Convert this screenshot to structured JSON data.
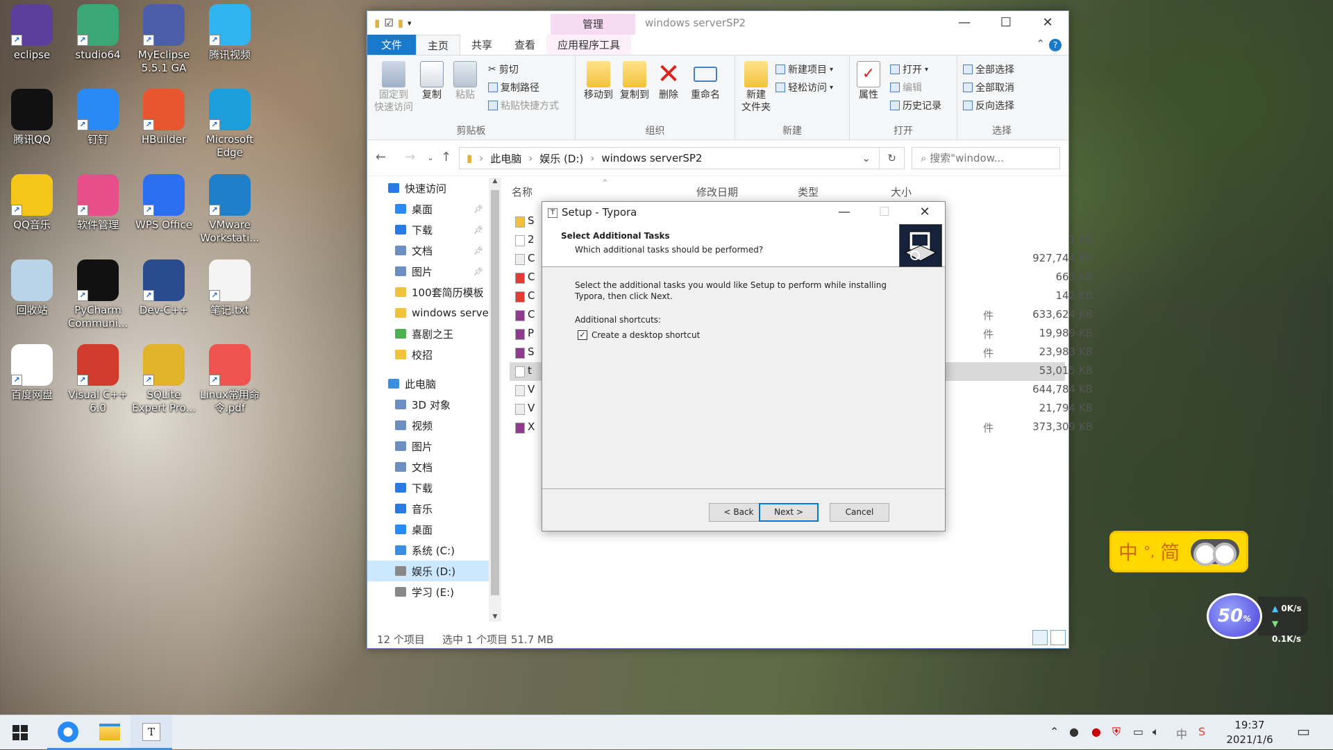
{
  "desktop": [
    {
      "label": "eclipse",
      "icon": "eclipse-icon",
      "color": "#5a3f9c"
    },
    {
      "label": "studio64",
      "icon": "android-studio-icon",
      "color": "#3aa776"
    },
    {
      "label": "MyEclipse 5.5.1 GA",
      "icon": "myeclipse-icon",
      "color": "#4d5ea8"
    },
    {
      "label": "腾讯视频",
      "icon": "tencent-video-icon",
      "color": "#2fb4f0"
    },
    {
      "label": "腾讯QQ",
      "icon": "qq-icon",
      "color": "#111111"
    },
    {
      "label": "钉钉",
      "icon": "dingtalk-icon",
      "color": "#2a8af5"
    },
    {
      "label": "HBuilder",
      "icon": "hbuilder-icon",
      "color": "#e8552e"
    },
    {
      "label": "Microsoft Edge",
      "icon": "edge-icon",
      "color": "#1b9ed9"
    },
    {
      "label": "QQ音乐",
      "icon": "qq-music-icon",
      "color": "#f5c518"
    },
    {
      "label": "软件管理",
      "icon": "software-manager-icon",
      "color": "#e84e8a"
    },
    {
      "label": "WPS Office",
      "icon": "wps-icon",
      "color": "#2c6ef2"
    },
    {
      "label": "VMware Workstati...",
      "icon": "vmware-icon",
      "color": "#1f7fc8"
    },
    {
      "label": "回收站",
      "icon": "recycle-bin-icon",
      "color": "#b9d4e8"
    },
    {
      "label": "PyCharm Communi...",
      "icon": "pycharm-icon",
      "color": "#111111"
    },
    {
      "label": "Dev-C++",
      "icon": "devcpp-icon",
      "color": "#2a4b8d"
    },
    {
      "label": "笔记.txt",
      "icon": "text-file-icon",
      "color": "#f4f4f4"
    },
    {
      "label": "百度网盘",
      "icon": "baidu-netdisk-icon",
      "color": "#ffffff"
    },
    {
      "label": "Visual C++ 6.0",
      "icon": "visual-cpp-icon",
      "color": "#d23a2b"
    },
    {
      "label": "SQLite Expert Pro...",
      "icon": "sqlite-icon",
      "color": "#e0b32a"
    },
    {
      "label": "Linux常用命令.pdf",
      "icon": "pdf-file-icon",
      "color": "#ef5350"
    }
  ],
  "explorer": {
    "window_title": "windows serverSP2",
    "manage_tab": "管理",
    "tabs": {
      "file": "文件",
      "home": "主页",
      "share": "共享",
      "view": "查看",
      "app_tools": "应用程序工具"
    },
    "ribbon": {
      "pin": "固定到\n快速访问",
      "copy": "复制",
      "paste": "粘贴",
      "cut": "剪切",
      "copy_path": "复制路径",
      "paste_shortcut": "粘贴快捷方式",
      "g_clipboard": "剪贴板",
      "move_to": "移动到",
      "copy_to": "复制到",
      "delete": "删除",
      "rename": "重命名",
      "g_organize": "组织",
      "new_folder": "新建\n文件夹",
      "new_item": "新建项目",
      "easy_access": "轻松访问",
      "g_new": "新建",
      "properties": "属性",
      "open": "打开",
      "edit": "编辑",
      "history": "历史记录",
      "g_open": "打开",
      "select_all": "全部选择",
      "select_none": "全部取消",
      "invert": "反向选择",
      "g_select": "选择"
    },
    "path": [
      "此电脑",
      "娱乐 (D:)",
      "windows serverSP2"
    ],
    "search_placeholder": "搜索\"window...",
    "nav": [
      {
        "label": "快速访问",
        "icon": "star-icon",
        "level": 0,
        "pinned": false
      },
      {
        "label": "桌面",
        "icon": "desktop-folder-icon",
        "level": 1,
        "pinned": true
      },
      {
        "label": "下载",
        "icon": "download-folder-icon",
        "level": 1,
        "pinned": true
      },
      {
        "label": "文档",
        "icon": "documents-folder-icon",
        "level": 1,
        "pinned": true
      },
      {
        "label": "图片",
        "icon": "pictures-folder-icon",
        "level": 1,
        "pinned": true
      },
      {
        "label": "100套简历模板",
        "icon": "folder-icon",
        "level": 1,
        "pinned": false
      },
      {
        "label": "windows serve",
        "icon": "folder-icon",
        "level": 1,
        "pinned": false
      },
      {
        "label": "喜剧之王",
        "icon": "app-folder-icon",
        "level": 1,
        "pinned": false
      },
      {
        "label": "校招",
        "icon": "folder-icon",
        "level": 1,
        "pinned": false
      },
      {
        "label": "此电脑",
        "icon": "computer-icon",
        "level": 0,
        "pinned": false
      },
      {
        "label": "3D 对象",
        "icon": "3d-objects-icon",
        "level": 1,
        "pinned": false
      },
      {
        "label": "视频",
        "icon": "videos-folder-icon",
        "level": 1,
        "pinned": false
      },
      {
        "label": "图片",
        "icon": "pictures-folder-icon",
        "level": 1,
        "pinned": false
      },
      {
        "label": "文档",
        "icon": "documents-folder-icon",
        "level": 1,
        "pinned": false
      },
      {
        "label": "下载",
        "icon": "download-folder-icon",
        "level": 1,
        "pinned": false
      },
      {
        "label": "音乐",
        "icon": "music-folder-icon",
        "level": 1,
        "pinned": false
      },
      {
        "label": "桌面",
        "icon": "desktop-folder-icon",
        "level": 1,
        "pinned": false
      },
      {
        "label": "系统 (C:)",
        "icon": "system-drive-icon",
        "level": 1,
        "pinned": false
      },
      {
        "label": "娱乐 (D:)",
        "icon": "drive-icon",
        "level": 1,
        "pinned": false,
        "selected": true
      },
      {
        "label": "学习 (E:)",
        "icon": "drive-icon",
        "level": 1,
        "pinned": false
      }
    ],
    "columns": {
      "name": "名称",
      "date": "修改日期",
      "type": "类型",
      "size": "大小"
    },
    "files": [
      {
        "name": "S",
        "type": "",
        "size": "",
        "icon": "folder-icon"
      },
      {
        "name": "2",
        "type": "",
        "size": "1 KB",
        "icon": "text-file-icon"
      },
      {
        "name": "C",
        "type": "",
        "size": "927,744 KB",
        "icon": "disc-image-icon"
      },
      {
        "name": "C",
        "type": "",
        "size": "663 KB",
        "icon": "pdf-file-icon"
      },
      {
        "name": "C",
        "type": "",
        "size": "142 KB",
        "icon": "pdf-file-icon"
      },
      {
        "name": "C",
        "type": "件",
        "size": "633,624 KB",
        "icon": "archive-icon"
      },
      {
        "name": "P",
        "type": "件",
        "size": "19,989 KB",
        "icon": "archive-icon"
      },
      {
        "name": "S",
        "type": "件",
        "size": "23,983 KB",
        "icon": "archive-icon"
      },
      {
        "name": "t",
        "type": "",
        "size": "53,015 KB",
        "icon": "typora-installer-icon",
        "selected": true
      },
      {
        "name": "V",
        "type": "",
        "size": "644,784 KB",
        "icon": "disc-image-icon"
      },
      {
        "name": "V",
        "type": "",
        "size": "21,794 KB",
        "icon": "disc-image-icon"
      },
      {
        "name": "X",
        "type": "件",
        "size": "373,309 KB",
        "icon": "archive-icon"
      }
    ],
    "status": {
      "count": "12 个项目",
      "selection": "选中 1 个项目  51.7 MB"
    }
  },
  "dialog": {
    "title": "Setup - Typora",
    "heading": "Select Additional Tasks",
    "subheading": "Which additional tasks should be performed?",
    "intro": "Select the additional tasks you would like Setup to perform while installing Typora, then click Next.",
    "section": "Additional shortcuts:",
    "checkbox_label": "Create a desktop shortcut",
    "checkbox_checked": true,
    "back": "< Back",
    "next": "Next >",
    "cancel": "Cancel"
  },
  "ime": {
    "mode": "中",
    "dot": "°,",
    "simplified": "简"
  },
  "speed": {
    "percent": "50",
    "percent_suffix": "%",
    "up": "0K/s",
    "down": "0.1K/s"
  },
  "taskbar": {
    "time": "19:37",
    "date": "2021/1/6",
    "lang": "中"
  }
}
